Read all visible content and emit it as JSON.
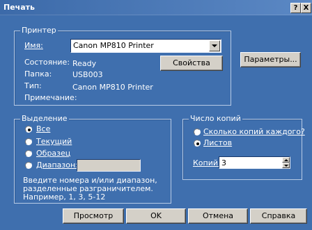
{
  "window": {
    "title": "Печать",
    "help_glyph": "?",
    "close_glyph": "X"
  },
  "printer": {
    "group_label": "Принтер",
    "name_label": "Имя:",
    "name_value": "Canon MP810 Printer",
    "status_label": "Состояние:",
    "status_value": "Ready",
    "folder_label": "Папка:",
    "folder_value": "USB003",
    "type_label": "Тип:",
    "type_value": "Canon MP810 Printer",
    "comment_label": "Примечание:",
    "properties_button": "Свойства",
    "parameters_button": "Параметры..."
  },
  "selection": {
    "group_label": "Выделение",
    "options": [
      "Все",
      "Текущий",
      "Образец",
      "Диапазон:"
    ],
    "selected": "Все",
    "range_value": "",
    "hint": [
      "Введите номера и/или диапазон,",
      "разделенные разграничителем.",
      "Например, 1, 3, 5-12"
    ]
  },
  "copies": {
    "group_label": "Число копий",
    "options": [
      "Сколько копий каждого?",
      "Листов"
    ],
    "selected": "Листов",
    "copies_label": "Копий:",
    "copies_value": "3"
  },
  "footer": {
    "preview": "Просмотр",
    "ok": "OK",
    "cancel": "Отмена",
    "help": "Справка"
  }
}
